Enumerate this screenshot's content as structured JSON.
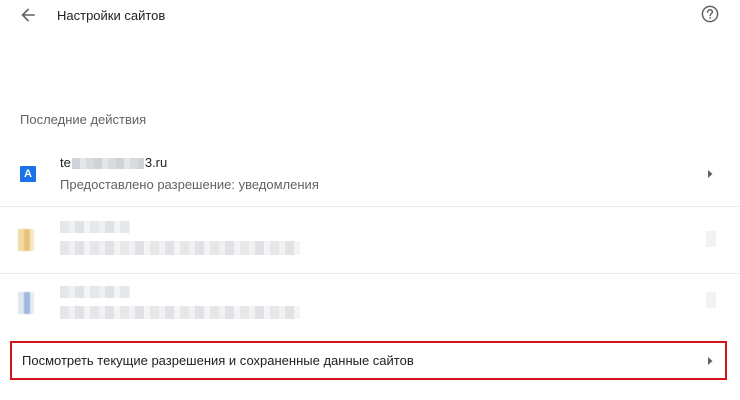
{
  "header": {
    "title": "Настройки сайтов",
    "back_icon": "arrow-back-icon",
    "help_icon": "help-circle-icon"
  },
  "recent": {
    "title": "Последние действия",
    "items": [
      {
        "site_prefix": "te",
        "site_suffix": "3.ru",
        "description": "Предоставлено разрешение: уведомления",
        "icon_letter": "A"
      }
    ]
  },
  "view_all": {
    "label": "Посмотреть текущие разрешения и сохраненные данные сайтов"
  },
  "colors": {
    "highlight_border": "#d4151c",
    "favicon_blue": "#1a73e8"
  }
}
